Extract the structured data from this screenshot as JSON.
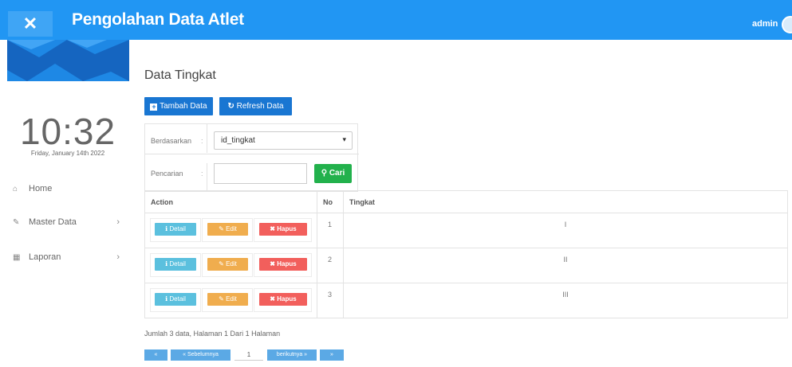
{
  "header": {
    "title": "Pengolahan Data Atlet",
    "user": "admin",
    "menu_icon": "close-icon"
  },
  "sidebar": {
    "clock": "10:32",
    "date": "Friday, January 14th 2022",
    "items": [
      {
        "label": "Home",
        "icon": "home-icon"
      },
      {
        "label": "Master Data",
        "icon": "edit-icon",
        "chevron": "›"
      },
      {
        "label": "Laporan",
        "icon": "calendar-icon",
        "chevron": "›"
      }
    ]
  },
  "main": {
    "page_title": "Data Tingkat",
    "buttons": {
      "add_label": "Tambah Data",
      "refresh_label": "Refresh Data"
    },
    "filter": {
      "sort_label": "Berdasarkan",
      "colon": ":",
      "sort_value": "id_tingkat",
      "search_label": "Pencarian",
      "search_value": "",
      "search_button": "Cari"
    },
    "table": {
      "headers": [
        "Action",
        "No",
        "Tingkat"
      ],
      "action_labels": {
        "detail": "Detail",
        "edit": "Edit",
        "delete": "Hapus"
      },
      "rows": [
        {
          "no": "1",
          "tingkat": "I"
        },
        {
          "no": "2",
          "tingkat": "II"
        },
        {
          "no": "3",
          "tingkat": "III"
        }
      ]
    },
    "summary": "Jumlah 3 data, Halaman 1 Dari 1 Halaman",
    "pagination": {
      "first": "«",
      "prev": "« Sebelumnya",
      "current": "1",
      "next": "berikutnya »",
      "last": "»"
    }
  },
  "colors": {
    "navbar": "#2196F3",
    "primary_button": "#1976D2",
    "search_button": "#22B14C",
    "detail": "#5BC0DE",
    "edit": "#F0AD4E",
    "delete": "#F25F5C"
  }
}
